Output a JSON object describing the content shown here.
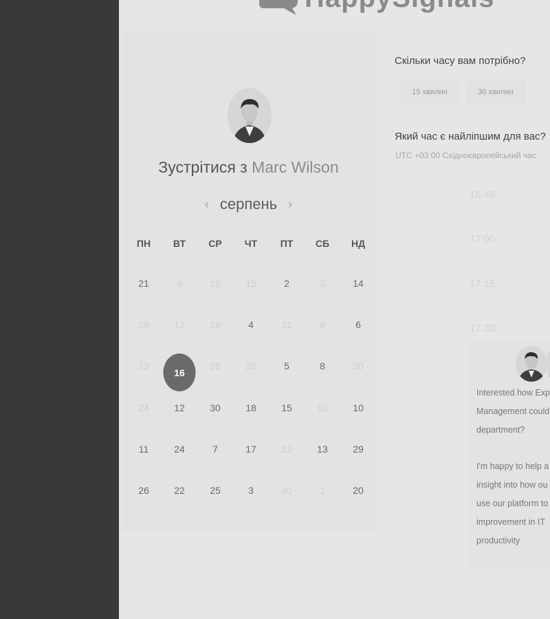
{
  "brand": {
    "name": "HappySignals"
  },
  "booking": {
    "title_prefix": "Зустрітися з",
    "host_name": "Marc Wilson",
    "month": "серпень",
    "prev_arrow": "‹",
    "next_arrow": "›",
    "weekdays": [
      "ПН",
      "ВТ",
      "СР",
      "ЧТ",
      "ПТ",
      "СБ",
      "НД"
    ],
    "days": [
      [
        "21",
        "4",
        "19",
        "15",
        "2",
        "3",
        "14"
      ],
      [
        "29",
        "12",
        "18",
        "4",
        "11",
        "8",
        "6"
      ],
      [
        "13",
        "16",
        "28",
        "26",
        "5",
        "8",
        "20"
      ],
      [
        "24",
        "12",
        "30",
        "18",
        "15",
        "10",
        "10"
      ],
      [
        "11",
        "24",
        "7",
        "17",
        "12",
        "13",
        "29"
      ],
      [
        "26",
        "22",
        "25",
        "3",
        "30",
        "1",
        "20"
      ]
    ],
    "muted_days": [
      [
        1,
        2,
        3,
        5
      ],
      [
        0,
        1,
        2,
        4,
        5
      ],
      [
        0,
        2,
        3,
        6
      ],
      [
        0,
        5
      ],
      [
        4
      ],
      [
        4,
        5
      ]
    ],
    "selected_day": "16"
  },
  "duration": {
    "question": "Скільки часу вам потрібно?",
    "options": [
      "15 хвилин",
      "30 хвилин"
    ]
  },
  "time": {
    "question": "Який час є найліпшим для вас?",
    "timezone": "UTC +03:00 Східноєвропейський час",
    "slots": [
      "16:45",
      "17:00",
      "17:15",
      "17:30"
    ]
  },
  "profile": {
    "lines": [
      "Interested how Exp",
      "Management could",
      "department?",
      "",
      "I'm happy to help a",
      "insight into how ou",
      "use our platform to",
      "improvement in IT",
      "productivity"
    ]
  },
  "colors": {
    "sidebar": "#393939",
    "selected_day": "#6a6a6a"
  }
}
